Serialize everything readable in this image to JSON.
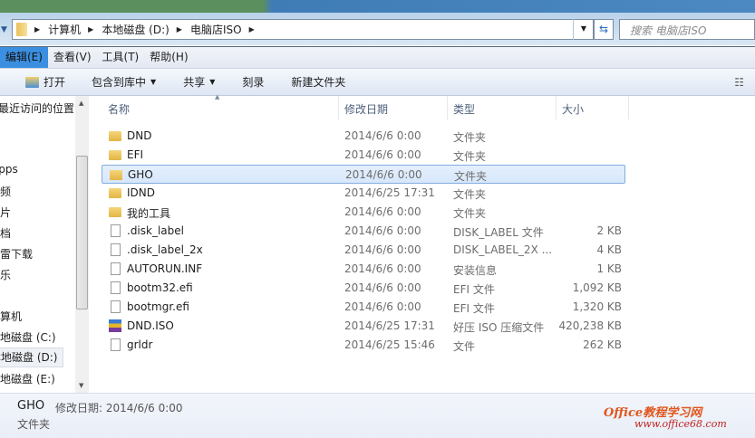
{
  "address": {
    "crumbs": [
      "计算机",
      "本地磁盘 (D:)",
      "电脑店ISO"
    ],
    "search_placeholder": "搜索 电脑店ISO"
  },
  "menu": [
    "编辑(E)",
    "查看(V)",
    "工具(T)",
    "帮助(H)"
  ],
  "toolbar": {
    "open": "打开",
    "include": "包含到库中",
    "share": "共享",
    "burn": "刻录",
    "new_folder": "新建文件夹"
  },
  "sidebar": [
    "最近访问的位置",
    "Apps",
    "视频",
    "图片",
    "文档",
    "迅雷下载",
    "音乐",
    "计算机",
    "本地磁盘 (C:)",
    "本地磁盘 (D:)",
    "本地磁盘 (E:)"
  ],
  "columns": {
    "name": "名称",
    "date": "修改日期",
    "type": "类型",
    "size": "大小"
  },
  "files": [
    {
      "name": "DND",
      "date": "2014/6/6 0:00",
      "type": "文件夹",
      "size": "",
      "icon": "folder"
    },
    {
      "name": "EFI",
      "date": "2014/6/6 0:00",
      "type": "文件夹",
      "size": "",
      "icon": "folder"
    },
    {
      "name": "GHO",
      "date": "2014/6/6 0:00",
      "type": "文件夹",
      "size": "",
      "icon": "folder"
    },
    {
      "name": "IDND",
      "date": "2014/6/25 17:31",
      "type": "文件夹",
      "size": "",
      "icon": "folder"
    },
    {
      "name": "我的工具",
      "date": "2014/6/6 0:00",
      "type": "文件夹",
      "size": "",
      "icon": "folder"
    },
    {
      "name": ".disk_label",
      "date": "2014/6/6 0:00",
      "type": "DISK_LABEL 文件",
      "size": "2 KB",
      "icon": "file"
    },
    {
      "name": ".disk_label_2x",
      "date": "2014/6/6 0:00",
      "type": "DISK_LABEL_2X ...",
      "size": "4 KB",
      "icon": "file"
    },
    {
      "name": "AUTORUN.INF",
      "date": "2014/6/6 0:00",
      "type": "安装信息",
      "size": "1 KB",
      "icon": "settings-file"
    },
    {
      "name": "bootm32.efi",
      "date": "2014/6/6 0:00",
      "type": "EFI 文件",
      "size": "1,092 KB",
      "icon": "file"
    },
    {
      "name": "bootmgr.efi",
      "date": "2014/6/6 0:00",
      "type": "EFI 文件",
      "size": "1,320 KB",
      "icon": "file"
    },
    {
      "name": "DND.ISO",
      "date": "2014/6/25 17:31",
      "type": "好压 ISO 压缩文件",
      "size": "420,238 KB",
      "icon": "archive"
    },
    {
      "name": "grldr",
      "date": "2014/6/25 15:46",
      "type": "文件",
      "size": "262 KB",
      "icon": "file"
    }
  ],
  "selected_index": 2,
  "status": {
    "name": "GHO",
    "modified_label": "修改日期: 2014/6/6 0:00",
    "type": "文件夹"
  },
  "watermark": {
    "line1": "Office教程学习网",
    "line2": "www.office68.com"
  }
}
